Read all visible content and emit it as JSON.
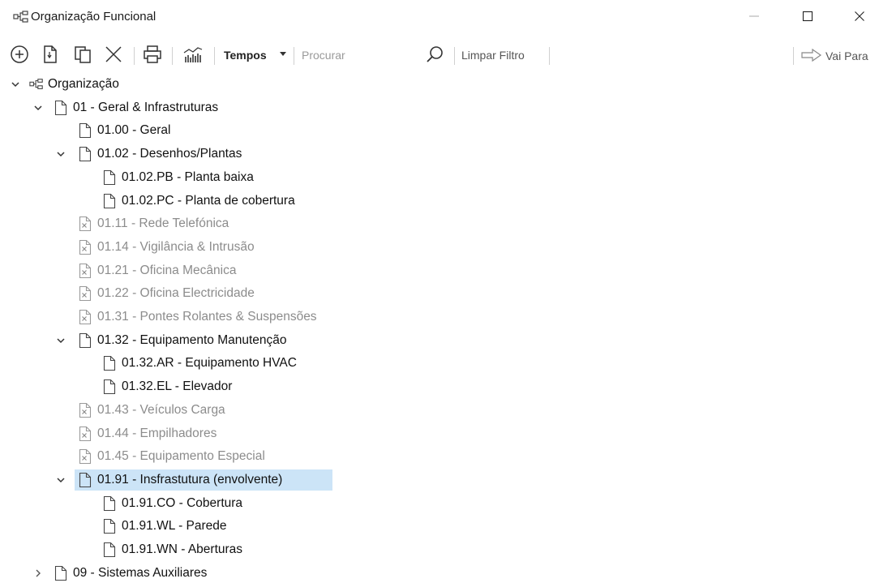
{
  "window": {
    "title": "Organização Funcional",
    "icon": "hierarchy-icon",
    "controls": [
      "minimize-icon",
      "maximize-icon",
      "close-icon"
    ]
  },
  "toolbar": {
    "icons": [
      "add-circle-icon",
      "new-document-icon",
      "copy-icon",
      "delete-icon",
      "print-icon",
      "chart-icon"
    ],
    "tempos_label": "Tempos",
    "search_placeholder": "Procurar",
    "search_value": "",
    "search_icon": "search-icon",
    "clear_filter_label": "Limpar Filtro",
    "goto_label": "Vai Para",
    "goto_icon": "arrow-right-icon"
  },
  "colors": {
    "selection": "#cce4f7",
    "disabled_text": "#8c8c8c",
    "text": "#111111"
  },
  "tree": {
    "root": {
      "label": "Organização",
      "expanded": true,
      "icon": "hierarchy-icon"
    },
    "nodes": [
      {
        "label": "01 - Geral & Infrastruturas",
        "level": 1,
        "state": "expanded",
        "disabled": false,
        "selected": false,
        "icon": "document-icon"
      },
      {
        "label": "01.00 - Geral",
        "level": 2,
        "state": "leaf",
        "disabled": false,
        "selected": false,
        "icon": "document-icon"
      },
      {
        "label": "01.02 - Desenhos/Plantas",
        "level": 2,
        "state": "expanded",
        "disabled": false,
        "selected": false,
        "icon": "document-icon"
      },
      {
        "label": "01.02.PB - Planta baixa",
        "level": 3,
        "state": "leaf",
        "disabled": false,
        "selected": false,
        "icon": "document-icon"
      },
      {
        "label": "01.02.PC - Planta de cobertura",
        "level": 3,
        "state": "leaf",
        "disabled": false,
        "selected": false,
        "icon": "document-icon"
      },
      {
        "label": "01.11 - Rede Telefónica",
        "level": 2,
        "state": "leaf",
        "disabled": true,
        "selected": false,
        "icon": "disabled-document-icon"
      },
      {
        "label": "01.14 - Vigilância & Intrusão",
        "level": 2,
        "state": "leaf",
        "disabled": true,
        "selected": false,
        "icon": "disabled-document-icon"
      },
      {
        "label": "01.21 - Oficina Mecânica",
        "level": 2,
        "state": "leaf",
        "disabled": true,
        "selected": false,
        "icon": "disabled-document-icon"
      },
      {
        "label": "01.22 - Oficina Electricidade",
        "level": 2,
        "state": "leaf",
        "disabled": true,
        "selected": false,
        "icon": "disabled-document-icon"
      },
      {
        "label": "01.31 - Pontes Rolantes & Suspensões",
        "level": 2,
        "state": "leaf",
        "disabled": true,
        "selected": false,
        "icon": "disabled-document-icon"
      },
      {
        "label": "01.32 - Equipamento Manutenção",
        "level": 2,
        "state": "expanded",
        "disabled": false,
        "selected": false,
        "icon": "document-icon"
      },
      {
        "label": "01.32.AR - Equipamento HVAC",
        "level": 3,
        "state": "leaf",
        "disabled": false,
        "selected": false,
        "icon": "document-icon"
      },
      {
        "label": "01.32.EL - Elevador",
        "level": 3,
        "state": "leaf",
        "disabled": false,
        "selected": false,
        "icon": "document-icon"
      },
      {
        "label": "01.43 - Veículos Carga",
        "level": 2,
        "state": "leaf",
        "disabled": true,
        "selected": false,
        "icon": "disabled-document-icon"
      },
      {
        "label": "01.44 - Empilhadores",
        "level": 2,
        "state": "leaf",
        "disabled": true,
        "selected": false,
        "icon": "disabled-document-icon"
      },
      {
        "label": "01.45 - Equipamento Especial",
        "level": 2,
        "state": "leaf",
        "disabled": true,
        "selected": false,
        "icon": "disabled-document-icon"
      },
      {
        "label": "01.91 - Insfrastutura (envolvente)",
        "level": 2,
        "state": "expanded",
        "disabled": false,
        "selected": true,
        "icon": "document-icon"
      },
      {
        "label": "01.91.CO - Cobertura",
        "level": 3,
        "state": "leaf",
        "disabled": false,
        "selected": false,
        "icon": "document-icon"
      },
      {
        "label": "01.91.WL - Parede",
        "level": 3,
        "state": "leaf",
        "disabled": false,
        "selected": false,
        "icon": "document-icon"
      },
      {
        "label": "01.91.WN - Aberturas",
        "level": 3,
        "state": "leaf",
        "disabled": false,
        "selected": false,
        "icon": "document-icon"
      },
      {
        "label": "09 - Sistemas Auxiliares",
        "level": 1,
        "state": "collapsed",
        "disabled": false,
        "selected": false,
        "icon": "document-icon"
      }
    ]
  }
}
